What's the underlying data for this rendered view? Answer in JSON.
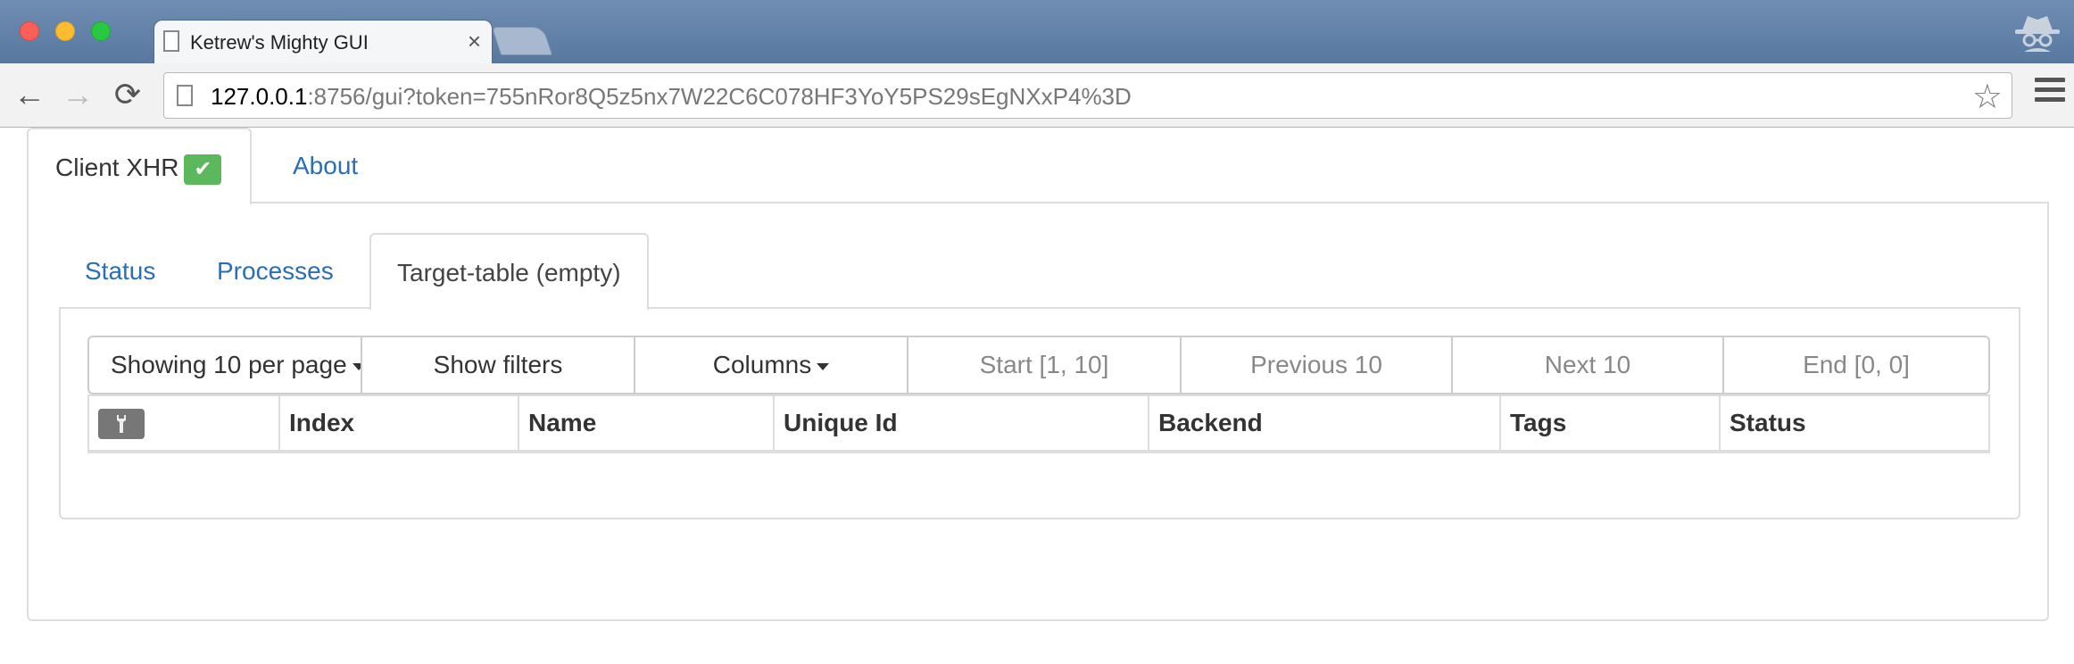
{
  "browser": {
    "tab_title": "Ketrew's Mighty GUI",
    "tab_close": "×",
    "url_host": "127.0.0.1",
    "url_rest": ":8756/gui?token=755nRor8Q5z5nx7W22C6C078HF3YoY5PS29sEgNXxP4%3D",
    "back_icon": "←",
    "forward_icon": "→",
    "reload_icon": "⟳",
    "star_icon": "☆",
    "traffic_lights": {
      "close": "#fc5f57",
      "minimize": "#fdbc2e",
      "zoom": "#28c840"
    }
  },
  "top_tabs": [
    {
      "label": "Client XHR",
      "badge": "✔",
      "active": true
    },
    {
      "label": "About",
      "active": false
    }
  ],
  "sub_tabs": [
    {
      "label": "Status",
      "active": false
    },
    {
      "label": "Processes",
      "active": false
    },
    {
      "label": "Target-table (empty)",
      "active": true
    }
  ],
  "controls": {
    "per_page": "Showing 10 per page",
    "show_filters": "Show filters",
    "columns": "Columns",
    "start": "Start [1, 10]",
    "previous": "Previous 10",
    "next": "Next 10",
    "end": "End [0, 0]"
  },
  "table": {
    "tool_icon": "wrench-icon",
    "headers": [
      "Index",
      "Name",
      "Unique Id",
      "Backend",
      "Tags",
      "Status"
    ]
  },
  "colors": {
    "link": "#2a6fb5",
    "success_badge": "#5cb85c",
    "titlebar": "#6f8db1"
  }
}
